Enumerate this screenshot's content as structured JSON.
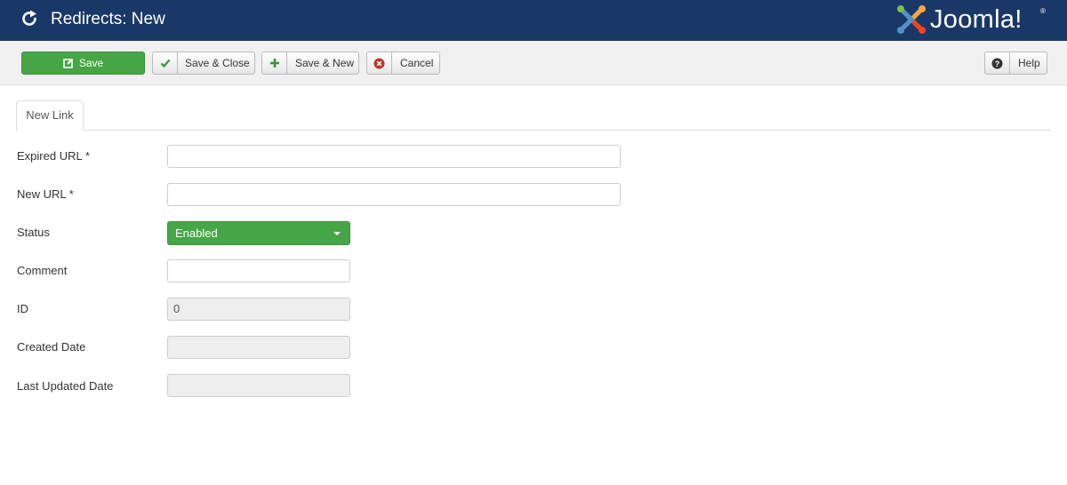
{
  "header": {
    "title": "Redirects: New",
    "brand_name": "Joomla!",
    "brand_reg": "®",
    "color": "#1a3867"
  },
  "toolbar": {
    "save_label": "Save",
    "save_close_label": "Save & Close",
    "save_new_label": "Save & New",
    "cancel_label": "Cancel",
    "help_label": "Help",
    "save_color": "#46a546"
  },
  "tabs": [
    {
      "label": "New Link",
      "active": true
    }
  ],
  "form": {
    "expired_url": {
      "label": "Expired URL *",
      "value": ""
    },
    "new_url": {
      "label": "New URL *",
      "value": ""
    },
    "status": {
      "label": "Status",
      "selected": "Enabled"
    },
    "comment": {
      "label": "Comment",
      "value": ""
    },
    "id": {
      "label": "ID",
      "value": "0"
    },
    "created_date": {
      "label": "Created Date",
      "value": ""
    },
    "last_updated_date": {
      "label": "Last Updated Date",
      "value": ""
    }
  },
  "icons": {
    "header": "refresh-icon",
    "brand": "joomla-logo-icon",
    "save": "edit-icon",
    "save_close": "check-icon",
    "save_new": "plus-icon",
    "cancel": "cancel-circle-icon",
    "help": "question-circle-icon"
  }
}
